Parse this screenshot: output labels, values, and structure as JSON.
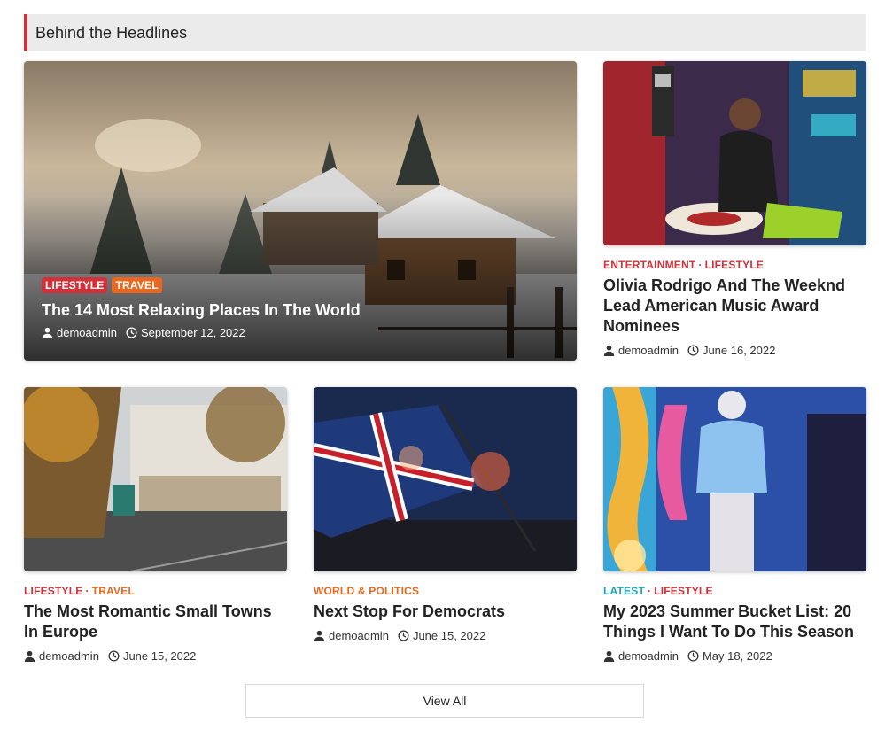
{
  "section": {
    "title": "Behind the Headlines"
  },
  "colors": {
    "accent": "#d1323a",
    "travel": "#e8681f",
    "politics": "#e8681f",
    "latest": "#1aa6b7"
  },
  "hero": {
    "categories": [
      "LIFESTYLE",
      "TRAVEL"
    ],
    "title": "The 14 Most Relaxing Places In The World",
    "author": "demoadmin",
    "date": "September 12, 2022"
  },
  "side_post": {
    "categories": [
      "ENTERTAINMENT",
      "LIFESTYLE"
    ],
    "title": "Olivia Rodrigo And The Weeknd Lead American Music Award Nominees",
    "author": "demoadmin",
    "date": "June 16, 2022"
  },
  "posts": [
    {
      "categories": [
        "LIFESTYLE",
        "TRAVEL"
      ],
      "title": "The Most Romantic Small Towns In Europe",
      "author": "demoadmin",
      "date": "June 15, 2022"
    },
    {
      "categories": [
        "WORLD & POLITICS"
      ],
      "title": "Next Stop For Democrats",
      "author": "demoadmin",
      "date": "June 15, 2022"
    },
    {
      "categories": [
        "LATEST",
        "LIFESTYLE"
      ],
      "title": "My 2023 Summer Bucket List: 20 Things I Want To Do This Season",
      "author": "demoadmin",
      "date": "May 18, 2022"
    }
  ],
  "icons": {
    "author": "user-icon",
    "date": "clock-icon"
  },
  "view_all": {
    "label": "View All"
  }
}
